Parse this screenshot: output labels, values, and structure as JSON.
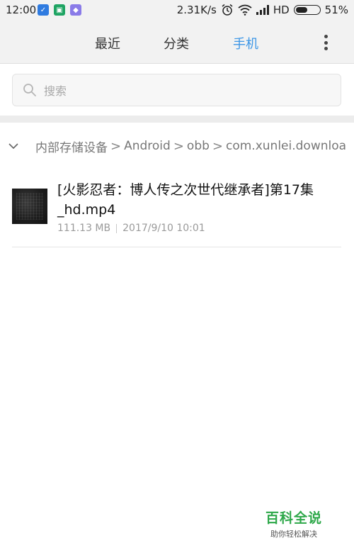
{
  "status_bar": {
    "time": "12:00",
    "network_speed": "2.31K/s",
    "signal_label": "HD",
    "battery_percent": "51%",
    "battery_level": 0.51,
    "icons": [
      "notification-app-icon",
      "shield-icon",
      "app-icon",
      "alarm-icon",
      "wifi-icon",
      "signal-icon",
      "battery-icon"
    ]
  },
  "tabs": [
    {
      "label": "最近",
      "active": false
    },
    {
      "label": "分类",
      "active": false
    },
    {
      "label": "手机",
      "active": true
    }
  ],
  "colors": {
    "accent": "#3c96e6",
    "watermark": "#2ea84a"
  },
  "search": {
    "placeholder": "搜索"
  },
  "breadcrumb": {
    "items": [
      "内部存储设备",
      "Android",
      "obb",
      "com.xunlei.downloa"
    ]
  },
  "file": {
    "name": "[火影忍者：博人传之次世代继承者]第17集_hd.mp4",
    "size": "111.13 MB",
    "date": "2017/9/10 10:01"
  },
  "watermark": {
    "title": "百科全说",
    "subtitle": "助你轻松解决"
  }
}
